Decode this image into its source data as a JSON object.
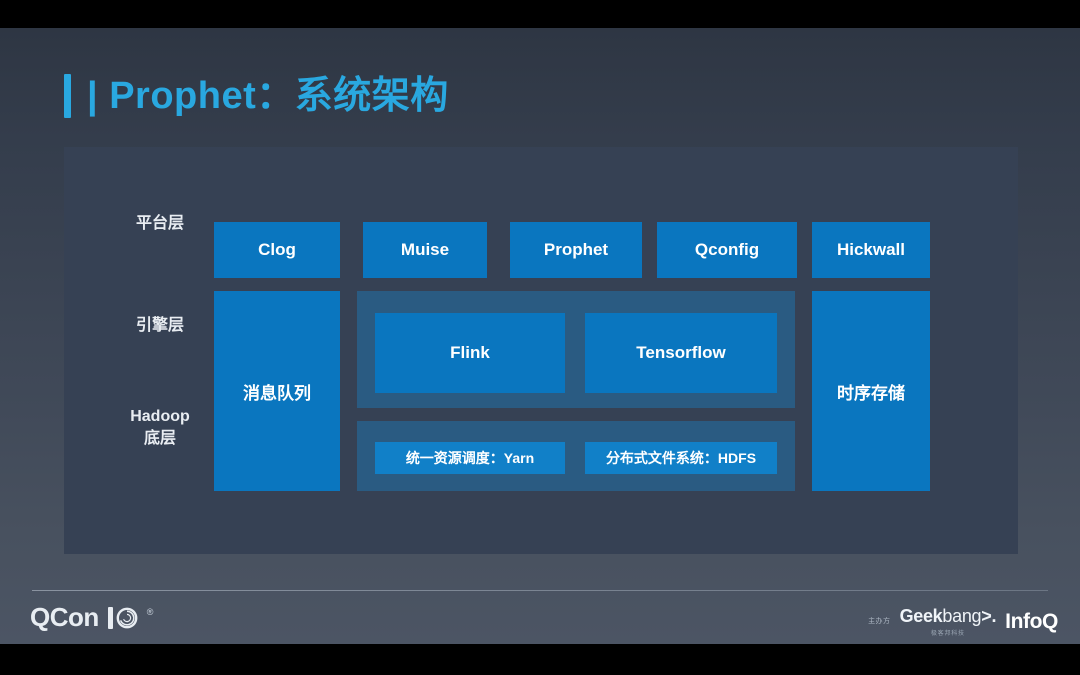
{
  "slide": {
    "title": "| Prophet：系统架构",
    "title_accent_color": "#29a8e0",
    "background_color": "#38414f",
    "panel_color": "#364154",
    "box_color": "#0a76bf",
    "container_color": "#2a5b82"
  },
  "labels": {
    "platform": "平台层",
    "engine": "引擎层",
    "hadoop_line1": "Hadoop",
    "hadoop_line2": "底层"
  },
  "platform_layer": {
    "boxes": [
      {
        "label": "Clog"
      },
      {
        "label": "Muise"
      },
      {
        "label": "Prophet"
      },
      {
        "label": "Qconfig"
      },
      {
        "label": "Hickwall"
      }
    ]
  },
  "engine_layer": {
    "message_queue": "消息队列",
    "time_series_storage": "时序存储",
    "compute_boxes": [
      {
        "label": "Flink"
      },
      {
        "label": "Tensorflow"
      }
    ]
  },
  "hadoop_layer": {
    "boxes": [
      {
        "label": "统一资源调度：Yarn"
      },
      {
        "label": "分布式文件系统：HDFS"
      }
    ]
  },
  "footer": {
    "brand": "QCon",
    "anniversary": "10",
    "organizer_label": "主办方",
    "geekbang_bold": "Geek",
    "geekbang_thin": "bang",
    "geekbang_mark": ">.",
    "geekbang_sub": "极客邦科技",
    "infoq": "InfoQ"
  }
}
